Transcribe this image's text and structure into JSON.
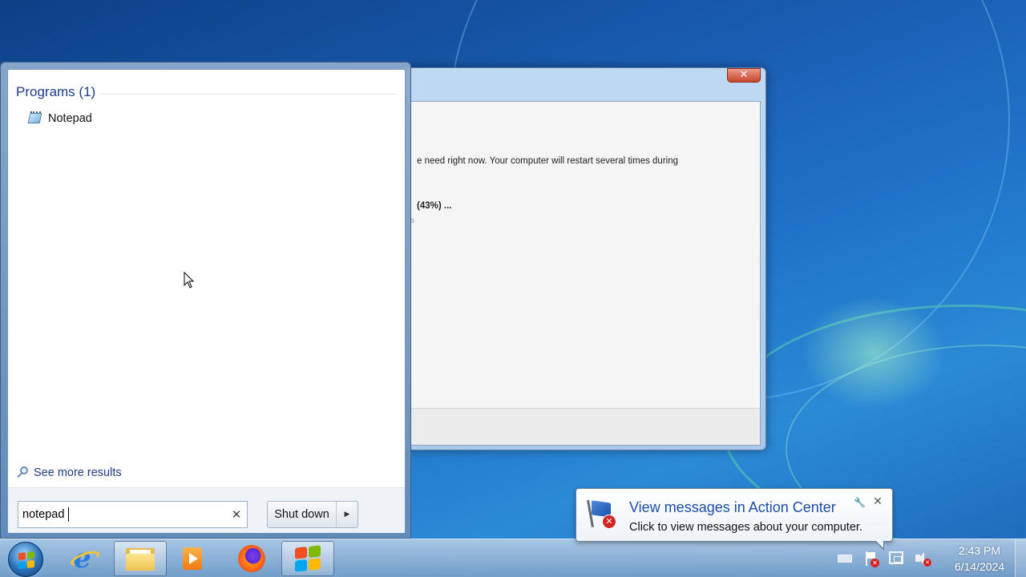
{
  "background_window": {
    "close_label": "✕",
    "text_line": "e need right now. Your computer will restart several times during",
    "progress_text": "(43%) ...",
    "faint_text": "s"
  },
  "start_menu": {
    "programs_heading": "Programs (1)",
    "program_items": [
      {
        "label": "Notepad",
        "icon": "notepad-icon"
      }
    ],
    "see_more_label": "See more results",
    "search": {
      "value": "notepad",
      "clear_label": "✕"
    },
    "shutdown_label": "Shut down",
    "shutdown_arrow": "▶"
  },
  "taskbar": {
    "apps": [
      {
        "name": "internet-explorer",
        "icon": "ie-icon",
        "active": false
      },
      {
        "name": "file-explorer",
        "icon": "folder-icon",
        "active": true
      },
      {
        "name": "media-player",
        "icon": "media-icon",
        "active": false
      },
      {
        "name": "firefox",
        "icon": "firefox-icon",
        "active": false
      },
      {
        "name": "windows-update",
        "icon": "windows-logo-icon",
        "active": true
      }
    ],
    "clock_time": "2:43 PM",
    "clock_date": "6/14/2024"
  },
  "action_center": {
    "title": "View messages in Action Center",
    "message": "Click to view messages about your computer.",
    "close_label": "✕",
    "wrench_label": "🔧"
  },
  "colors": {
    "accent": "#1e3c8a",
    "flag_red": "#f25022",
    "flag_green": "#7fba00",
    "flag_blue": "#00a4ef",
    "flag_yellow": "#ffb900"
  }
}
